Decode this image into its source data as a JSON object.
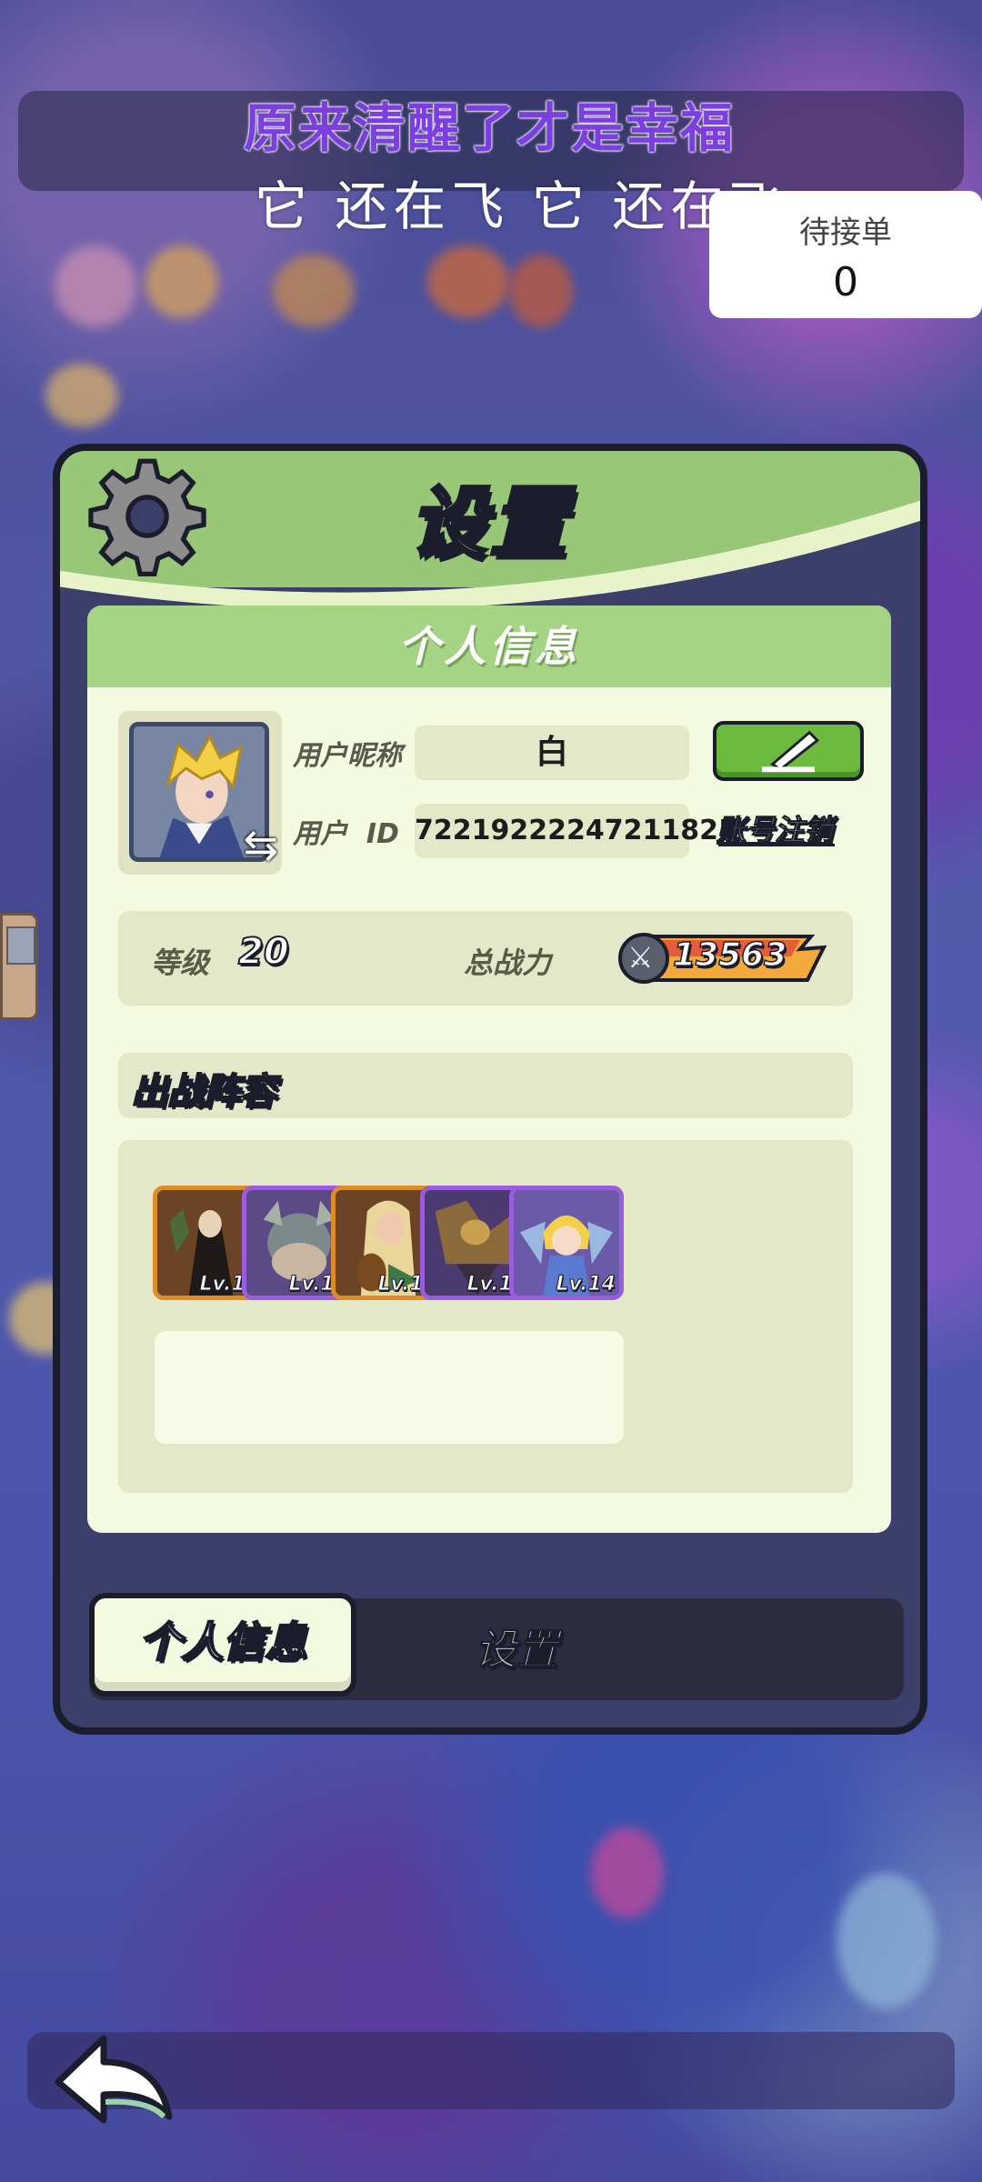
{
  "overlay": {
    "lyric_line1": "原来清醒了才是幸福",
    "lyric_line2": "它 还在飞 它 还在飞"
  },
  "pending_orders": {
    "label": "待接单",
    "count": "0"
  },
  "dialog": {
    "title": "设置",
    "section_title": "个人信息",
    "profile": {
      "nickname_label": "用户昵称",
      "nickname_value": "白",
      "id_label": "用户  ID",
      "id_value": "72219222247211825",
      "deregister_label": "账号注销",
      "edit_icon": "pencil-icon",
      "avatar_icon": "swap-icon"
    },
    "stats": {
      "level_label": "等级",
      "level_value": "20",
      "power_label": "总战力",
      "power_value": "13563"
    },
    "lineup": {
      "title": "出战阵容",
      "heroes": [
        {
          "level": "Lv.10",
          "rarity": "orange"
        },
        {
          "level": "Lv.12",
          "rarity": "purple"
        },
        {
          "level": "Lv.10",
          "rarity": "orange"
        },
        {
          "level": "Lv.16",
          "rarity": "purple"
        },
        {
          "level": "Lv.14",
          "rarity": "purple"
        }
      ]
    },
    "tabs": {
      "active": "个人信息",
      "inactive": "设置"
    }
  },
  "colors": {
    "header_green": "#98c777",
    "panel_cream": "#f4fadf",
    "rarity_orange": "#e08b2a",
    "rarity_purple": "#9b5ce0",
    "edit_button_green": "#6dbb3e"
  }
}
